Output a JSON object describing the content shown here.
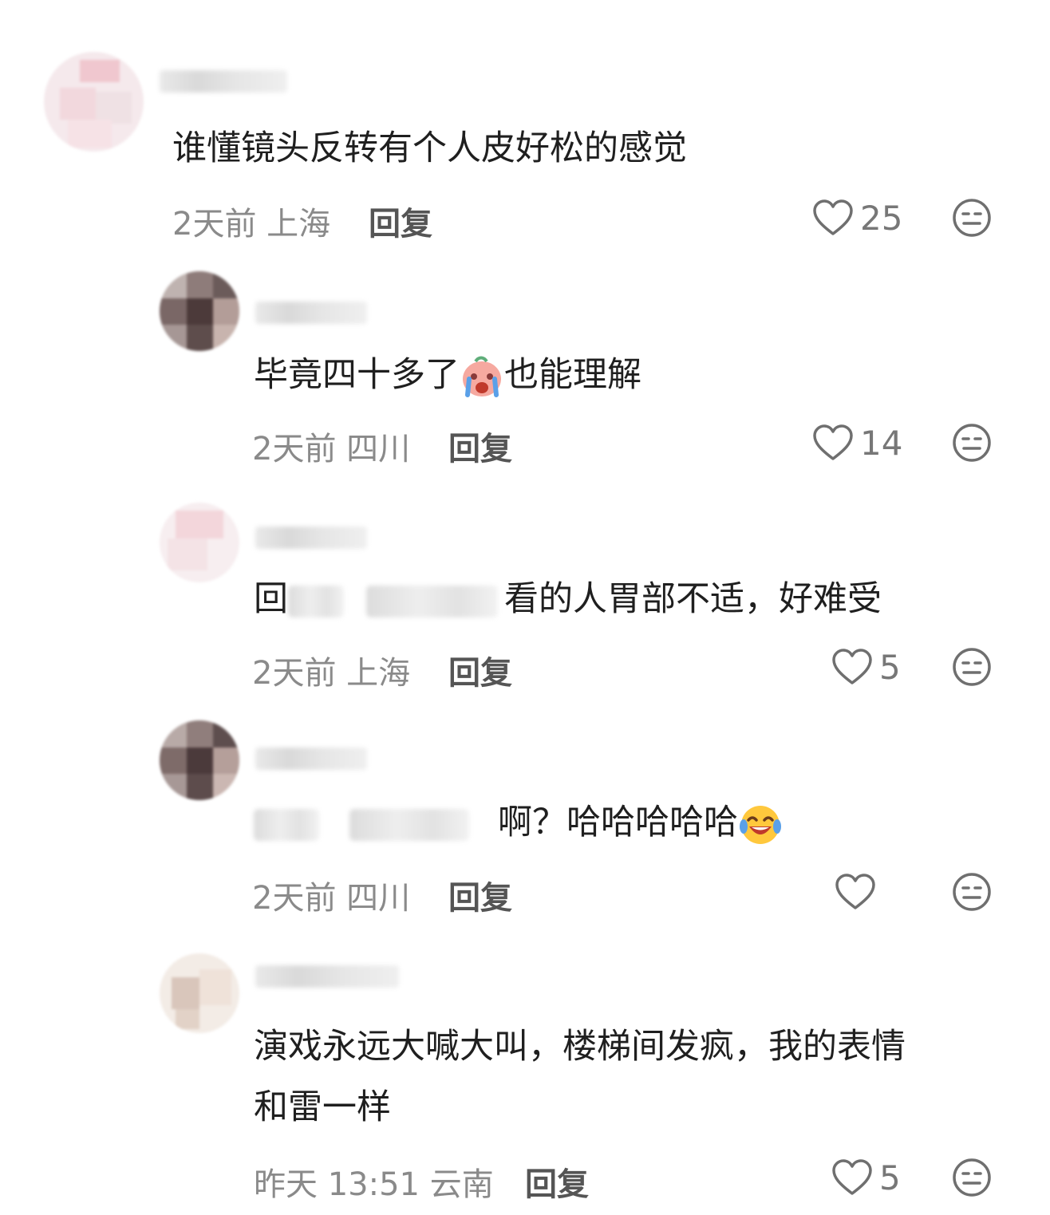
{
  "comments": [
    {
      "text": "谁懂镜头反转有个人皮好松的感觉",
      "time": "2天前",
      "location": "上海",
      "reply_label": "回复",
      "likes": "25"
    },
    {
      "text_before": "毕竟四十多了",
      "text_after": "也能理解",
      "emoji": "crying-face-emoji",
      "time": "2天前",
      "location": "四川",
      "reply_label": "回复",
      "likes": "14"
    },
    {
      "text_prefix": "回",
      "text": "看的人胃部不适，好难受",
      "time": "2天前",
      "location": "上海",
      "reply_label": "回复",
      "likes": "5"
    },
    {
      "text": "啊？哈哈哈哈哈",
      "emoji": "tears-of-joy-emoji",
      "time": "2天前",
      "location": "四川",
      "reply_label": "回复",
      "likes": ""
    },
    {
      "text_line1": "演戏永远大喊大叫，楼梯间发疯，我的表情",
      "text_line2": "和雷一样",
      "time": "昨天 13:51",
      "location": "云南",
      "reply_label": "回复",
      "likes": "5"
    }
  ],
  "colors": {
    "text": "#1f1f1f",
    "meta": "#8a8a8a",
    "reply": "#555555",
    "icon": "#6f6f6f"
  }
}
